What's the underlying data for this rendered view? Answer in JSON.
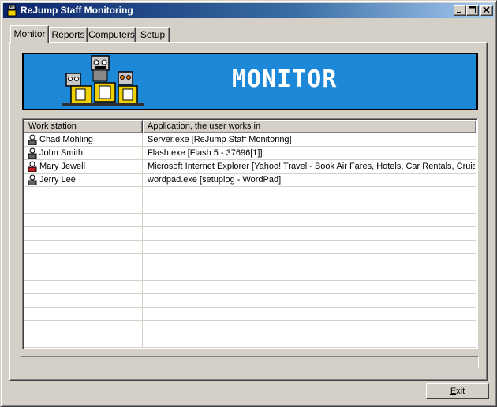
{
  "window": {
    "title": "ReJump Staff Monitoring",
    "controls": [
      "minimize-icon",
      "maximize-icon",
      "close-icon"
    ]
  },
  "tabs": [
    {
      "label": "Monitor",
      "active": true
    },
    {
      "label": "Reports",
      "active": false
    },
    {
      "label": "Computers",
      "active": false
    },
    {
      "label": "Setup",
      "active": false
    }
  ],
  "banner": {
    "title": "MONITOR",
    "background": "#1e88d8",
    "art_icon": "robots-with-computers-illustration"
  },
  "listview": {
    "columns": [
      "Work station",
      "Application, the user works in"
    ],
    "rows": [
      {
        "workstation": "Chad Mohling",
        "application": "Server.exe  [ReJump Staff Monitoring]",
        "icon": "user-icon",
        "icon_color": "#606060"
      },
      {
        "workstation": "John Smith",
        "application": "Flash.exe  [Flash 5 - 37696[1]]",
        "icon": "user-icon",
        "icon_color": "#606060"
      },
      {
        "workstation": "Mary Jewell",
        "application": "Microsoft Internet Explorer [Yahoo! Travel - Book Air Fares, Hotels, Car Rentals, Cruis...",
        "icon": "user-icon",
        "icon_color": "#c02020"
      },
      {
        "workstation": "Jerry Lee",
        "application": "wordpad.exe  [setuplog - WordPad]",
        "icon": "user-icon",
        "icon_color": "#606060"
      }
    ],
    "empty_rows": 12
  },
  "buttons": {
    "exit_prefix": "",
    "exit_mnemonic": "E",
    "exit_rest": "xit"
  },
  "colors": {
    "face": "#d4d0c8",
    "title_start": "#0a246a",
    "title_end": "#a6caf0"
  }
}
